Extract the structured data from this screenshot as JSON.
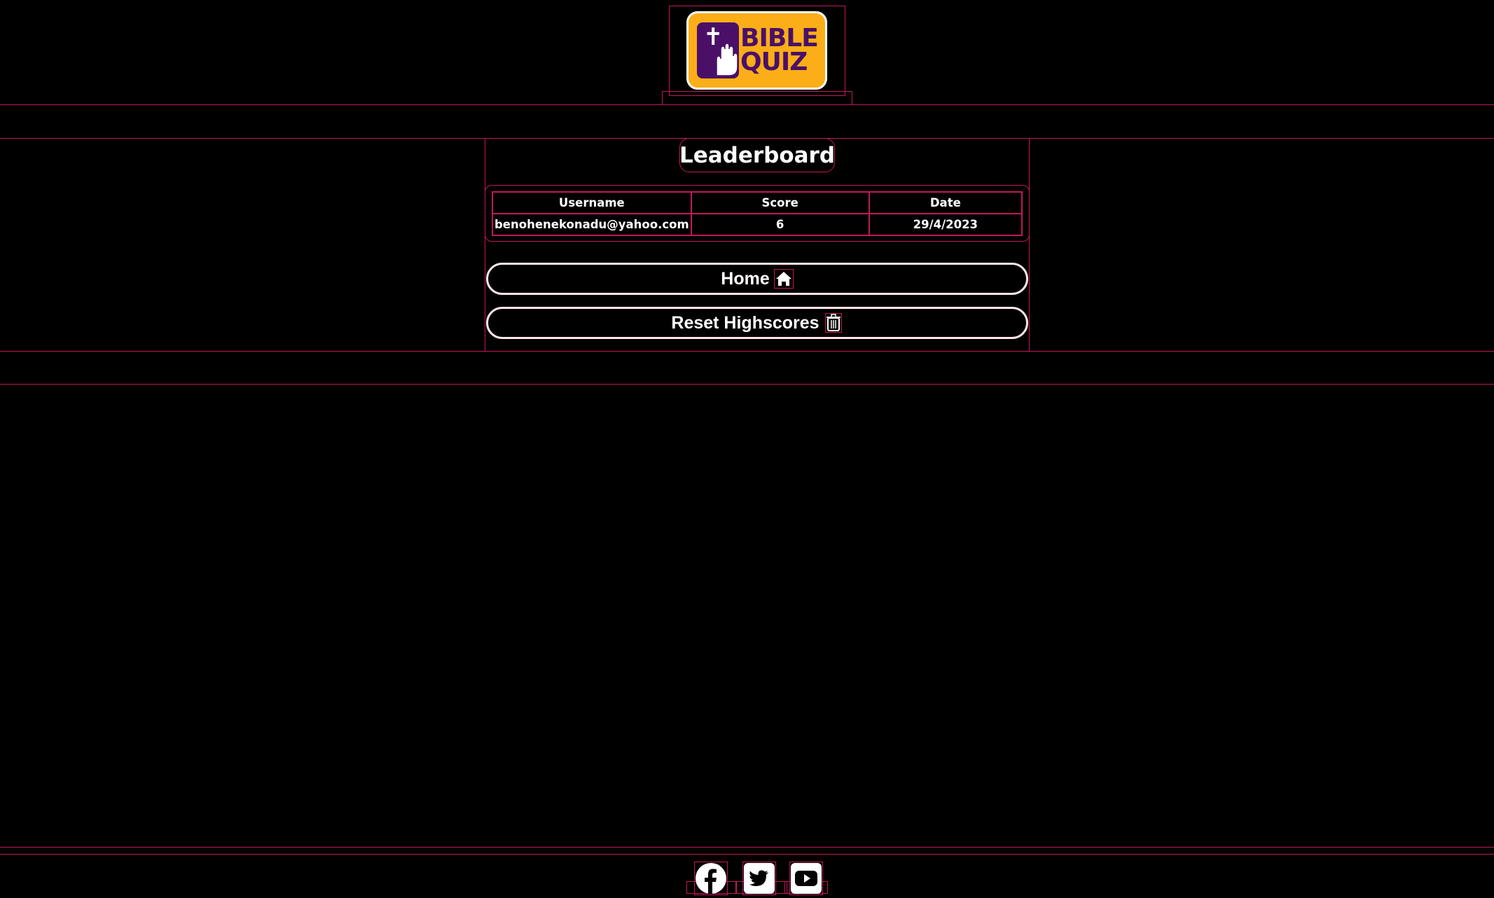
{
  "logo": {
    "line1": "BIBLE",
    "line2": "QUIZ",
    "cross": "✝"
  },
  "page": {
    "title": "Leaderboard"
  },
  "table": {
    "columns": [
      "Username",
      "Score",
      "Date"
    ],
    "rows": [
      [
        "benohenekonadu@yahoo.com",
        "6",
        "29/4/2023"
      ]
    ]
  },
  "buttons": {
    "home_label": "Home",
    "reset_label": "Reset Highscores"
  },
  "footer": {
    "social": [
      "facebook-icon",
      "twitter-icon",
      "youtube-icon"
    ]
  },
  "colors": {
    "background": "#000000",
    "outline": "#c2185b",
    "logo_bg": "#fbae17",
    "logo_purple": "#4a1068"
  }
}
